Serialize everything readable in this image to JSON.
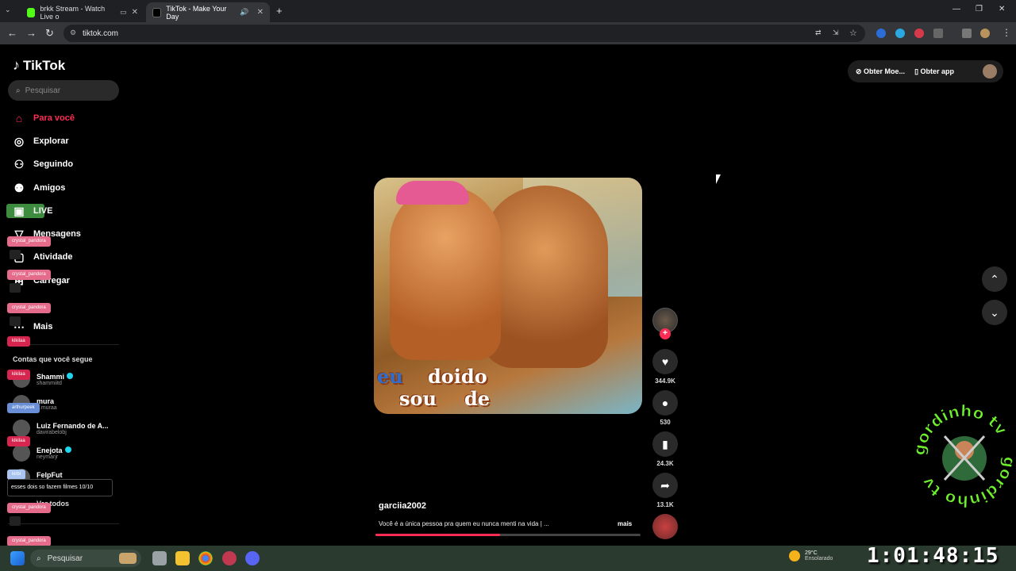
{
  "browser": {
    "tabs": [
      {
        "title": "brkk Stream - Watch Live o",
        "favicon_color": "#53fc18",
        "active": false
      },
      {
        "title": "TikTok - Make Your Day",
        "favicon_color": "#000000",
        "active": true
      }
    ],
    "new_tab_label": "+",
    "url": "tiktok.com"
  },
  "tiktok": {
    "logo": "TikTok",
    "search_placeholder": "Pesquisar",
    "nav": [
      {
        "label": "Para você",
        "icon": "home-icon",
        "active": true
      },
      {
        "label": "Explorar",
        "icon": "compass-icon"
      },
      {
        "label": "Seguindo",
        "icon": "following-icon"
      },
      {
        "label": "Amigos",
        "icon": "friends-icon"
      },
      {
        "label": "LIVE",
        "icon": "live-icon"
      },
      {
        "label": "Mensagens",
        "icon": "messages-icon"
      },
      {
        "label": "Atividade",
        "icon": "activity-icon"
      },
      {
        "label": "Carregar",
        "icon": "upload-icon"
      },
      {
        "label": "Mais",
        "icon": "more-icon"
      }
    ],
    "following_title": "Contas que você segue",
    "accounts": [
      {
        "name": "Shammi",
        "handle": "shammiitd",
        "verified": true
      },
      {
        "name": "mura",
        "handle": "_.muraa",
        "verified": false
      },
      {
        "name": "Luiz Fernando de A...",
        "handle": "davirabelobj",
        "verified": false
      },
      {
        "name": "Enejota",
        "handle": "neymarjr",
        "verified": true
      },
      {
        "name": "FelpFut",
        "handle": "felpfut",
        "verified": false
      }
    ],
    "see_more": "Ver todos",
    "top_right": {
      "coins": "Obter Moe...",
      "app": "Obter app"
    },
    "video": {
      "caption_line1": [
        "eu",
        "doido"
      ],
      "caption_line2": [
        "sou",
        "de"
      ],
      "author": "garciia2002",
      "description": "Você é a única pessoa pra quem eu nunca menti na vida | ...",
      "more": "mais",
      "progress": 0.47,
      "likes": "344.9K",
      "comments": "530",
      "saves": "24.3K",
      "shares": "13.1K"
    }
  },
  "chat": {
    "tags": [
      {
        "user": "crystal_pandora",
        "color": "#e56b8a"
      },
      {
        "user": "crystal_pandora",
        "color": "#e56b8a"
      },
      {
        "user": "crystal_pandora",
        "color": "#e56b8a"
      },
      {
        "user": "kikilaa",
        "color": "#d6264f"
      },
      {
        "user": "kikilaa",
        "color": "#d6264f"
      },
      {
        "user": "arthurpeek",
        "color": "#6a8fd6"
      },
      {
        "user": "kikilaa",
        "color": "#d6264f"
      },
      {
        "user": "kirbi",
        "color": "#a9c4f0"
      },
      {
        "user": "crystal_pandora",
        "color": "#e56b8a"
      },
      {
        "user": "crystal_pandora",
        "color": "#e56b8a"
      }
    ],
    "message": "esses dois so fazem filmes 10/10"
  },
  "watermark": "gordinho tv",
  "taskbar": {
    "search": "Pesquisar",
    "weather_temp": "29°C",
    "weather_desc": "Ensolarado"
  },
  "stream_clock": "1:01:48:15"
}
